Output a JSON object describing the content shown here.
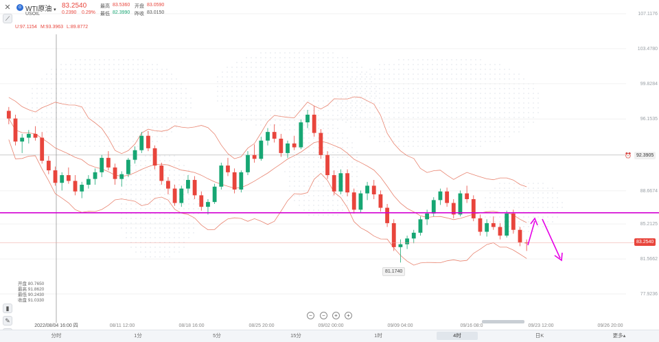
{
  "header": {
    "symbol_name": "WTI原油",
    "symbol_code": "USOIL",
    "last_price": "83.2540",
    "change": "0.2390",
    "change_pct": "0.29%",
    "high_label": "最高",
    "high_value": "83.5360",
    "low_label": "最低",
    "low_value": "82.3990",
    "open_label": "开盘",
    "open_value": "83.0590",
    "prev_close_label": "昨收",
    "prev_close_value": "83.0150"
  },
  "indicator": {
    "u": "U:97.1154",
    "m": "M:93.3963",
    "l": "L:89.8772"
  },
  "ohlc_panel": {
    "open": "开盘 80.7650",
    "high": "最高 91.8620",
    "low": "最低 90.2430",
    "close": "收盘 91.0330"
  },
  "y_axis_ticks": [
    "107.1176",
    "103.4780",
    "99.8284",
    "96.1535",
    "88.6674",
    "85.2125",
    "81.5662",
    "77.9236"
  ],
  "price_tags": {
    "crosshair_price": "92.3905",
    "last_price": "83.2540",
    "low_annotation": "81.1740"
  },
  "x_axis_ticks": [
    "2022/08/04 16:00 四",
    "08/11 12:00",
    "08/18 16:00",
    "08/25 20:00",
    "09/02 00:00",
    "09/09 04:00",
    "09/16 08:0",
    "09/23 12:00",
    "09/26 20:00"
  ],
  "timeframes": [
    "分时",
    "1分",
    "5分",
    "15分",
    "1时",
    "4时",
    "日K",
    "更多▴"
  ],
  "active_timeframe": "4时",
  "zoom_controls": [
    "−",
    "−",
    "+",
    "+"
  ],
  "colors": {
    "up": "#17a673",
    "down": "#e8453c",
    "bollinger": "#e8836f",
    "support_line": "#d400d4",
    "annotation_arrow": "#e600e6"
  },
  "chart_data": {
    "type": "candlestick",
    "title": "WTI原油",
    "timeframe": "4时",
    "ylim": [
      77.9236,
      107.1176
    ],
    "x_range": [
      "2022/08/04 16:00",
      "09/26 20:00"
    ],
    "overlays": [
      "bollinger"
    ],
    "bollinger": {
      "upper": 97.1154,
      "middle": 93.3963,
      "lower": 89.8772
    },
    "horizontal_line": 86.38,
    "last_price": 83.254,
    "marked_low": 81.174,
    "candles": [
      [
        97.0,
        97.4,
        95.6,
        96.2
      ],
      [
        96.2,
        96.6,
        93.4,
        93.8
      ],
      [
        93.8,
        94.6,
        92.6,
        94.2
      ],
      [
        94.2,
        95.0,
        93.6,
        94.6
      ],
      [
        94.6,
        95.4,
        93.9,
        94.2
      ],
      [
        94.2,
        94.8,
        91.5,
        91.8
      ],
      [
        91.8,
        92.3,
        90.4,
        90.8
      ],
      [
        90.8,
        91.2,
        89.2,
        89.5
      ],
      [
        89.5,
        90.6,
        88.7,
        90.3
      ],
      [
        90.3,
        91.1,
        89.4,
        89.7
      ],
      [
        89.7,
        90.3,
        88.2,
        88.6
      ],
      [
        88.6,
        89.6,
        87.9,
        89.3
      ],
      [
        89.3,
        90.3,
        88.9,
        89.9
      ],
      [
        89.9,
        91.0,
        89.3,
        90.6
      ],
      [
        90.6,
        92.4,
        90.1,
        92.1
      ],
      [
        92.1,
        92.8,
        90.8,
        91.1
      ],
      [
        91.1,
        91.5,
        89.3,
        89.9
      ],
      [
        89.9,
        90.7,
        89.1,
        90.4
      ],
      [
        90.4,
        92.1,
        90.1,
        91.9
      ],
      [
        91.9,
        93.3,
        91.5,
        92.9
      ],
      [
        92.9,
        94.8,
        92.6,
        94.4
      ],
      [
        94.4,
        94.9,
        92.8,
        93.1
      ],
      [
        93.1,
        93.4,
        90.9,
        91.3
      ],
      [
        91.3,
        91.6,
        89.3,
        89.7
      ],
      [
        89.7,
        90.1,
        88.3,
        88.9
      ],
      [
        88.9,
        89.3,
        87.1,
        87.4
      ],
      [
        87.4,
        89.2,
        87.0,
        88.9
      ],
      [
        88.9,
        90.3,
        88.4,
        89.8
      ],
      [
        89.8,
        90.2,
        87.8,
        88.2
      ],
      [
        88.2,
        88.6,
        86.6,
        87.0
      ],
      [
        87.0,
        87.8,
        86.2,
        87.5
      ],
      [
        87.5,
        89.4,
        87.3,
        89.1
      ],
      [
        89.1,
        91.6,
        88.8,
        91.3
      ],
      [
        91.3,
        92.1,
        90.2,
        90.6
      ],
      [
        90.6,
        91.0,
        88.4,
        88.8
      ],
      [
        88.8,
        90.8,
        88.5,
        90.6
      ],
      [
        90.6,
        92.8,
        90.3,
        92.4
      ],
      [
        92.4,
        93.5,
        91.6,
        92.0
      ],
      [
        92.0,
        94.3,
        91.8,
        93.9
      ],
      [
        93.9,
        95.2,
        93.4,
        94.8
      ],
      [
        94.8,
        95.6,
        93.7,
        94.1
      ],
      [
        94.1,
        94.6,
        92.2,
        92.6
      ],
      [
        92.6,
        93.9,
        92.1,
        93.6
      ],
      [
        93.6,
        94.4,
        92.9,
        93.2
      ],
      [
        93.2,
        96.1,
        93.0,
        95.8
      ],
      [
        95.8,
        97.1,
        95.2,
        96.6
      ],
      [
        96.6,
        97.5,
        94.3,
        94.7
      ],
      [
        94.7,
        95.1,
        92.0,
        92.4
      ],
      [
        92.4,
        92.8,
        89.9,
        90.3
      ],
      [
        90.3,
        90.8,
        88.2,
        88.6
      ],
      [
        88.6,
        90.9,
        88.3,
        90.5
      ],
      [
        90.5,
        90.9,
        88.1,
        88.5
      ],
      [
        88.5,
        88.9,
        86.3,
        86.7
      ],
      [
        86.7,
        88.7,
        86.4,
        88.4
      ],
      [
        88.4,
        89.6,
        87.7,
        89.2
      ],
      [
        89.2,
        89.8,
        87.8,
        88.3
      ],
      [
        88.3,
        88.7,
        86.5,
        86.9
      ],
      [
        86.9,
        87.3,
        84.9,
        85.3
      ],
      [
        85.3,
        85.7,
        82.4,
        82.8
      ],
      [
        82.8,
        83.6,
        81.2,
        83.1
      ],
      [
        83.1,
        84.0,
        82.6,
        83.7
      ],
      [
        83.7,
        84.6,
        83.2,
        84.3
      ],
      [
        84.3,
        86.0,
        84.0,
        85.7
      ],
      [
        85.7,
        86.7,
        85.1,
        86.3
      ],
      [
        86.3,
        88.0,
        86.0,
        87.7
      ],
      [
        87.7,
        88.9,
        87.2,
        88.6
      ],
      [
        88.6,
        89.0,
        87.0,
        87.4
      ],
      [
        87.4,
        87.8,
        85.8,
        86.2
      ],
      [
        86.2,
        88.7,
        86.0,
        88.4
      ],
      [
        88.4,
        89.2,
        87.4,
        87.8
      ],
      [
        87.8,
        88.2,
        85.5,
        85.8
      ],
      [
        85.8,
        86.2,
        84.0,
        84.4
      ],
      [
        84.4,
        85.7,
        83.9,
        85.3
      ],
      [
        85.3,
        86.0,
        84.6,
        84.9
      ],
      [
        84.9,
        85.3,
        83.6,
        84.0
      ],
      [
        84.0,
        86.6,
        83.8,
        86.3
      ],
      [
        86.3,
        86.7,
        84.2,
        84.6
      ],
      [
        84.6,
        84.9,
        82.9,
        83.3
      ],
      [
        83.3,
        83.6,
        82.4,
        83.2
      ]
    ]
  }
}
